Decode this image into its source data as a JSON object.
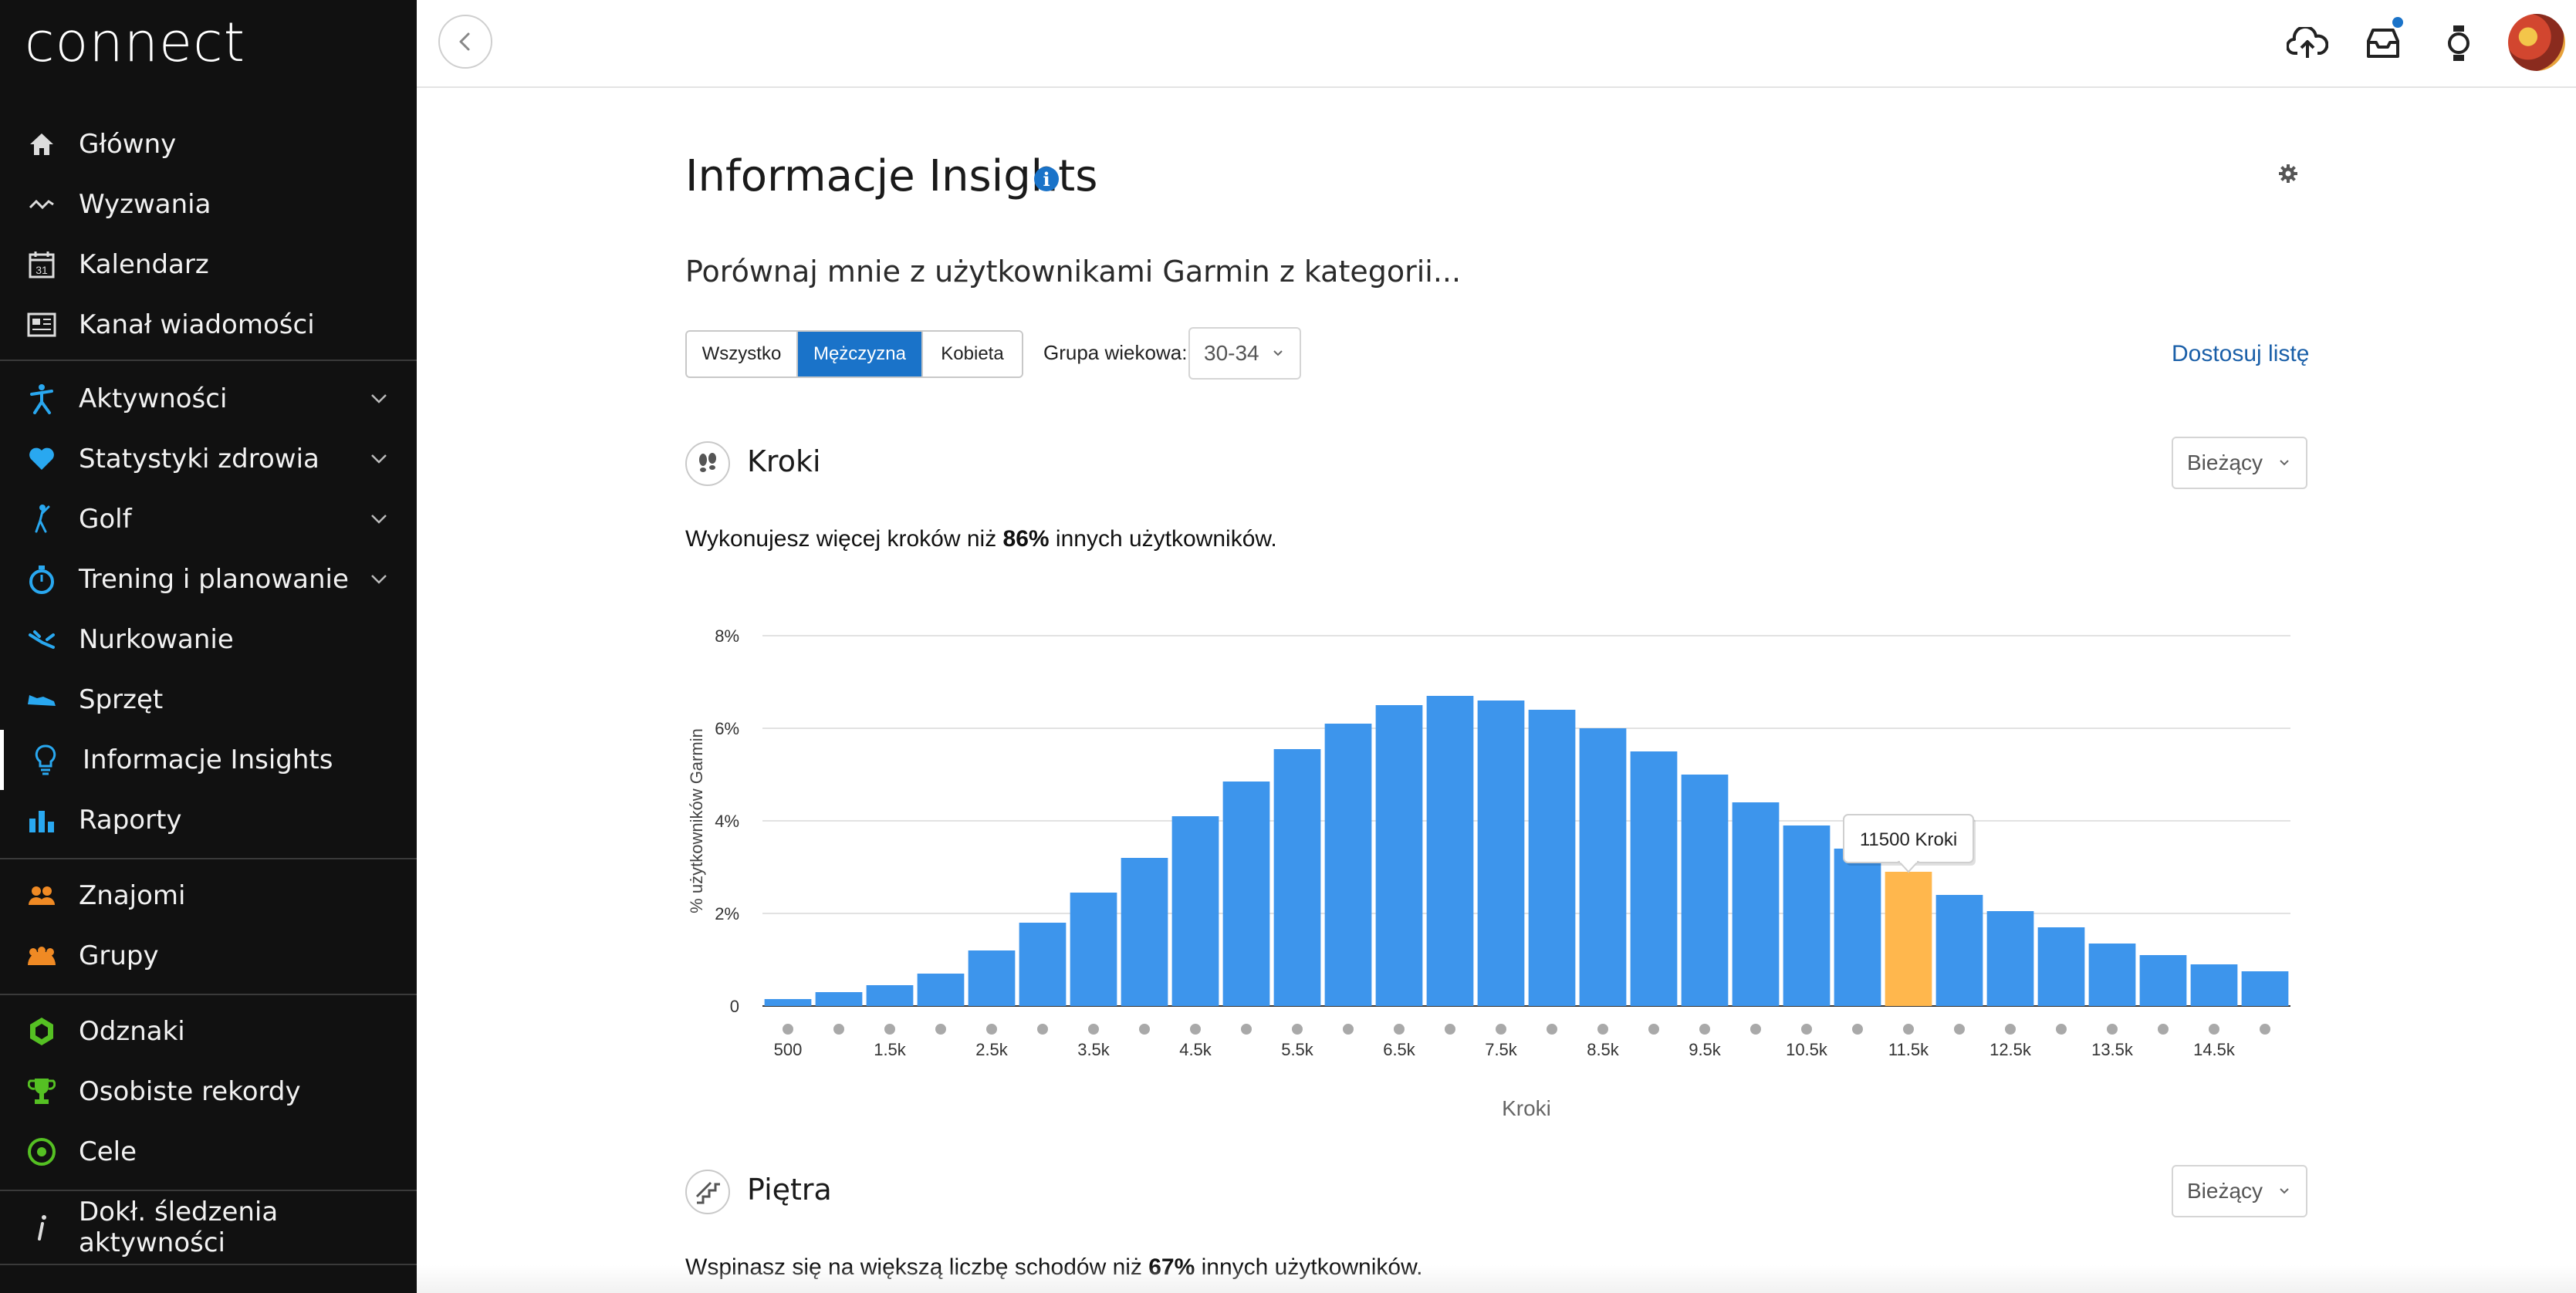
{
  "app": {
    "logo": "connect"
  },
  "sidebar": {
    "items": [
      {
        "label": "Główny",
        "icon": "home-icon"
      },
      {
        "label": "Wyzwania",
        "icon": "challenges-icon"
      },
      {
        "label": "Kalendarz",
        "icon": "calendar-icon",
        "icon_text": "31"
      },
      {
        "label": "Kanał wiadomości",
        "icon": "newsfeed-icon"
      },
      {
        "label": "Aktywności",
        "icon": "running-person-icon",
        "expandable": true
      },
      {
        "label": "Statystyki zdrowia",
        "icon": "heart-icon",
        "expandable": true
      },
      {
        "label": "Golf",
        "icon": "golfer-icon",
        "expandable": true
      },
      {
        "label": "Trening i planowanie",
        "icon": "stopwatch-icon",
        "expandable": true
      },
      {
        "label": "Nurkowanie",
        "icon": "diver-icon"
      },
      {
        "label": "Sprzęt",
        "icon": "shoe-icon"
      },
      {
        "label": "Informacje Insights",
        "icon": "lightbulb-icon",
        "active": true
      },
      {
        "label": "Raporty",
        "icon": "bar-chart-icon"
      },
      {
        "label": "Znajomi",
        "icon": "friends-icon"
      },
      {
        "label": "Grupy",
        "icon": "groups-icon"
      },
      {
        "label": "Odznaki",
        "icon": "badge-icon"
      },
      {
        "label": "Osobiste rekordy",
        "icon": "trophy-icon"
      },
      {
        "label": "Cele",
        "icon": "target-icon"
      },
      {
        "label": "Dokł. śledzenia aktywności",
        "icon": "info-italic-icon"
      }
    ]
  },
  "topbar": {
    "icons": [
      "back-chevron-icon",
      "upload-cloud-icon",
      "inbox-icon",
      "watch-icon",
      "avatar"
    ],
    "inbox_has_notification": true
  },
  "main": {
    "title": "Informacje Insights",
    "compare_text": "Porównaj mnie z użytkownikami Garmin z kategorii...",
    "gender_options": [
      "Wszystko",
      "Mężczyzna",
      "Kobieta"
    ],
    "gender_selected": "Mężczyzna",
    "age_label": "Grupa wiekowa:",
    "age_value": "30-34",
    "customize_link": "Dostosuj listę",
    "sections": [
      {
        "title": "Kroki",
        "icon": "footsteps-icon",
        "period": "Bieżący",
        "summary_pre": "Wykonujesz więcej kroków niż ",
        "summary_pct": "86%",
        "summary_post": " innych użytkowników."
      },
      {
        "title": "Piętra",
        "icon": "stairs-icon",
        "period": "Bieżący",
        "summary_pre": "Wspinasz się na większą liczbę schodów niż ",
        "summary_pct": "67%",
        "summary_post": " innych użytkowników."
      }
    ]
  },
  "colors": {
    "sidebar_bg": "#111111",
    "accent_blue": "#1a73c9",
    "bar_blue": "#3d95ec",
    "bar_highlight": "#ffb74d",
    "link_blue": "#1a5fa8"
  },
  "chart_data": {
    "type": "bar",
    "xlabel": "Kroki",
    "ylabel": "% użytkowników Garmin",
    "ylim": [
      0,
      8
    ],
    "y_ticks": [
      "0",
      "2%",
      "4%",
      "6%",
      "8%"
    ],
    "x_tick_labels": [
      "500",
      "1.5k",
      "2.5k",
      "3.5k",
      "4.5k",
      "5.5k",
      "6.5k",
      "7.5k",
      "8.5k",
      "9.5k",
      "10.5k",
      "11.5k",
      "12.5k",
      "13.5k",
      "14.5k"
    ],
    "categories": [
      "500",
      "1000",
      "1500",
      "2000",
      "2500",
      "3000",
      "3500",
      "4000",
      "4500",
      "5000",
      "5500",
      "6000",
      "6500",
      "7000",
      "7500",
      "8000",
      "8500",
      "9000",
      "9500",
      "10000",
      "10500",
      "11000",
      "11500",
      "12000",
      "12500",
      "13000",
      "13500",
      "14000",
      "14500",
      "15000"
    ],
    "values": [
      0.15,
      0.3,
      0.45,
      0.7,
      1.2,
      1.8,
      2.45,
      3.2,
      4.1,
      4.85,
      5.55,
      6.1,
      6.5,
      6.7,
      6.6,
      6.4,
      6.0,
      5.5,
      5.0,
      4.4,
      3.9,
      3.4,
      2.9,
      2.4,
      2.05,
      1.7,
      1.35,
      1.1,
      0.9,
      0.75
    ],
    "highlight_category": "11500",
    "tooltip": "11500 Kroki",
    "grid": true
  }
}
